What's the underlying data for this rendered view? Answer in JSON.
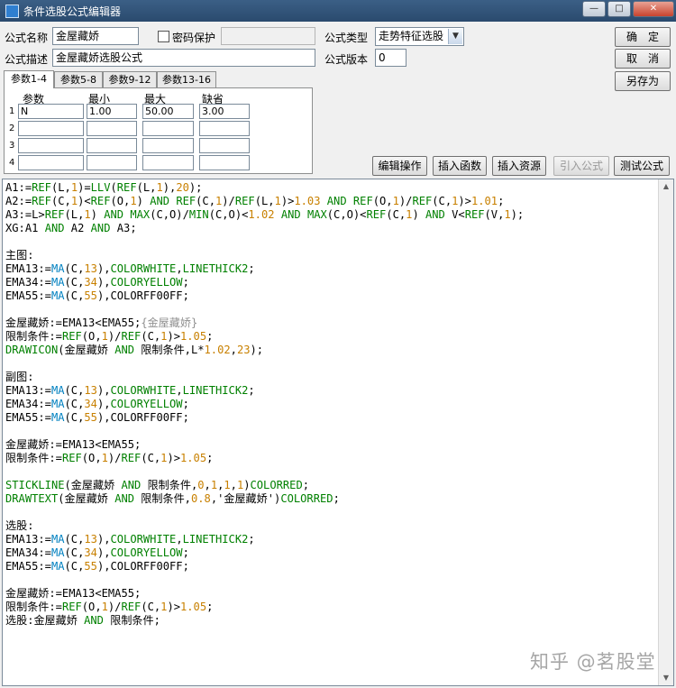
{
  "window": {
    "title": "条件选股公式编辑器",
    "min": "—",
    "max": "□",
    "close": "✕"
  },
  "form": {
    "name_label": "公式名称",
    "name_value": "金屋藏娇",
    "password_label": "密码保护",
    "password_value": "",
    "type_label": "公式类型",
    "type_value": "走势特征选股",
    "desc_label": "公式描述",
    "desc_value": "金屋藏娇选股公式",
    "version_label": "公式版本",
    "version_value": "0"
  },
  "buttons": {
    "ok": "确　定",
    "cancel": "取　消",
    "save_as": "另存为",
    "edit_ops": "编辑操作",
    "insert_func": "插入函数",
    "insert_res": "插入资源",
    "import_formula": "引入公式",
    "test_formula": "测试公式"
  },
  "tabs": [
    "参数1-4",
    "参数5-8",
    "参数9-12",
    "参数13-16"
  ],
  "params": {
    "headers": [
      "参数",
      "最小",
      "最大",
      "缺省"
    ],
    "rows": [
      {
        "num": "1",
        "name": "N",
        "min": "1.00",
        "max": "50.00",
        "default": "3.00"
      },
      {
        "num": "2",
        "name": "",
        "min": "",
        "max": "",
        "default": ""
      },
      {
        "num": "3",
        "name": "",
        "min": "",
        "max": "",
        "default": ""
      },
      {
        "num": "4",
        "name": "",
        "min": "",
        "max": "",
        "default": ""
      }
    ]
  },
  "colors": {
    "text": "#000000",
    "function": "#008000",
    "number": "#c88000",
    "constant": "#008000",
    "ma": "#0080c0",
    "comment": "#909090"
  },
  "code_lines": [
    [
      [
        "A1:=",
        "t"
      ],
      [
        "REF",
        "f"
      ],
      [
        "(L,",
        "t"
      ],
      [
        "1",
        "n"
      ],
      [
        ")=",
        "t"
      ],
      [
        "LLV",
        "f"
      ],
      [
        "(",
        "t"
      ],
      [
        "REF",
        "f"
      ],
      [
        "(L,",
        "t"
      ],
      [
        "1",
        "n"
      ],
      [
        "),",
        "t"
      ],
      [
        "20",
        "n"
      ],
      [
        ");",
        "t"
      ]
    ],
    [
      [
        "A2:=",
        "t"
      ],
      [
        "REF",
        "f"
      ],
      [
        "(C,",
        "t"
      ],
      [
        "1",
        "n"
      ],
      [
        ")<",
        "t"
      ],
      [
        "REF",
        "f"
      ],
      [
        "(O,",
        "t"
      ],
      [
        "1",
        "n"
      ],
      [
        ") ",
        "t"
      ],
      [
        "AND",
        "f"
      ],
      [
        " ",
        "t"
      ],
      [
        "REF",
        "f"
      ],
      [
        "(C,",
        "t"
      ],
      [
        "1",
        "n"
      ],
      [
        ")/",
        "t"
      ],
      [
        "REF",
        "f"
      ],
      [
        "(L,",
        "t"
      ],
      [
        "1",
        "n"
      ],
      [
        ")>",
        "t"
      ],
      [
        "1.03",
        "n"
      ],
      [
        " ",
        "t"
      ],
      [
        "AND",
        "f"
      ],
      [
        " ",
        "t"
      ],
      [
        "REF",
        "f"
      ],
      [
        "(O,",
        "t"
      ],
      [
        "1",
        "n"
      ],
      [
        ")/",
        "t"
      ],
      [
        "REF",
        "f"
      ],
      [
        "(C,",
        "t"
      ],
      [
        "1",
        "n"
      ],
      [
        ")>",
        "t"
      ],
      [
        "1.01",
        "n"
      ],
      [
        ";",
        "t"
      ]
    ],
    [
      [
        "A3:=L>",
        "t"
      ],
      [
        "REF",
        "f"
      ],
      [
        "(L,",
        "t"
      ],
      [
        "1",
        "n"
      ],
      [
        ") ",
        "t"
      ],
      [
        "AND",
        "f"
      ],
      [
        " ",
        "t"
      ],
      [
        "MAX",
        "f"
      ],
      [
        "(C,O)/",
        "t"
      ],
      [
        "MIN",
        "f"
      ],
      [
        "(C,O)<",
        "t"
      ],
      [
        "1.02",
        "n"
      ],
      [
        " ",
        "t"
      ],
      [
        "AND",
        "f"
      ],
      [
        " ",
        "t"
      ],
      [
        "MAX",
        "f"
      ],
      [
        "(C,O)<",
        "t"
      ],
      [
        "REF",
        "f"
      ],
      [
        "(C,",
        "t"
      ],
      [
        "1",
        "n"
      ],
      [
        ") ",
        "t"
      ],
      [
        "AND",
        "f"
      ],
      [
        " V<",
        "t"
      ],
      [
        "REF",
        "f"
      ],
      [
        "(V,",
        "t"
      ],
      [
        "1",
        "n"
      ],
      [
        ");",
        "t"
      ]
    ],
    [
      [
        "XG:A1 ",
        "t"
      ],
      [
        "AND",
        "f"
      ],
      [
        " A2 ",
        "t"
      ],
      [
        "AND",
        "f"
      ],
      [
        " A3;",
        "t"
      ]
    ],
    [],
    [
      [
        "主图:",
        "t"
      ]
    ],
    [
      [
        "EMA13:=",
        "t"
      ],
      [
        "MA",
        "m"
      ],
      [
        "(C,",
        "t"
      ],
      [
        "13",
        "n"
      ],
      [
        "),",
        "t"
      ],
      [
        "COLORWHITE",
        "c"
      ],
      [
        ",",
        "t"
      ],
      [
        "LINETHICK2",
        "c"
      ],
      [
        ";",
        "t"
      ]
    ],
    [
      [
        "EMA34:=",
        "t"
      ],
      [
        "MA",
        "m"
      ],
      [
        "(C,",
        "t"
      ],
      [
        "34",
        "n"
      ],
      [
        "),",
        "t"
      ],
      [
        "COLORYELLOW",
        "c"
      ],
      [
        ";",
        "t"
      ]
    ],
    [
      [
        "EMA55:=",
        "t"
      ],
      [
        "MA",
        "m"
      ],
      [
        "(C,",
        "t"
      ],
      [
        "55",
        "n"
      ],
      [
        "),COLORFF00FF;",
        "t"
      ]
    ],
    [],
    [
      [
        "金屋藏娇:=EMA13<EMA55;",
        "t"
      ],
      [
        "{金屋藏娇}",
        "x"
      ]
    ],
    [
      [
        "限制条件:=",
        "t"
      ],
      [
        "REF",
        "f"
      ],
      [
        "(O,",
        "t"
      ],
      [
        "1",
        "n"
      ],
      [
        ")/",
        "t"
      ],
      [
        "REF",
        "f"
      ],
      [
        "(C,",
        "t"
      ],
      [
        "1",
        "n"
      ],
      [
        ")>",
        "t"
      ],
      [
        "1.05",
        "n"
      ],
      [
        ";",
        "t"
      ]
    ],
    [
      [
        "DRAWICON",
        "f"
      ],
      [
        "(金屋藏娇 ",
        "t"
      ],
      [
        "AND",
        "f"
      ],
      [
        " 限制条件,L*",
        "t"
      ],
      [
        "1.02",
        "n"
      ],
      [
        ",",
        "t"
      ],
      [
        "23",
        "n"
      ],
      [
        ");",
        "t"
      ]
    ],
    [],
    [
      [
        "副图:",
        "t"
      ]
    ],
    [
      [
        "EMA13:=",
        "t"
      ],
      [
        "MA",
        "m"
      ],
      [
        "(C,",
        "t"
      ],
      [
        "13",
        "n"
      ],
      [
        "),",
        "t"
      ],
      [
        "COLORWHITE",
        "c"
      ],
      [
        ",",
        "t"
      ],
      [
        "LINETHICK2",
        "c"
      ],
      [
        ";",
        "t"
      ]
    ],
    [
      [
        "EMA34:=",
        "t"
      ],
      [
        "MA",
        "m"
      ],
      [
        "(C,",
        "t"
      ],
      [
        "34",
        "n"
      ],
      [
        "),",
        "t"
      ],
      [
        "COLORYELLOW",
        "c"
      ],
      [
        ";",
        "t"
      ]
    ],
    [
      [
        "EMA55:=",
        "t"
      ],
      [
        "MA",
        "m"
      ],
      [
        "(C,",
        "t"
      ],
      [
        "55",
        "n"
      ],
      [
        "),COLORFF00FF;",
        "t"
      ]
    ],
    [],
    [
      [
        "金屋藏娇:=EMA13<EMA55;",
        "t"
      ]
    ],
    [
      [
        "限制条件:=",
        "t"
      ],
      [
        "REF",
        "f"
      ],
      [
        "(O,",
        "t"
      ],
      [
        "1",
        "n"
      ],
      [
        ")/",
        "t"
      ],
      [
        "REF",
        "f"
      ],
      [
        "(C,",
        "t"
      ],
      [
        "1",
        "n"
      ],
      [
        ")>",
        "t"
      ],
      [
        "1.05",
        "n"
      ],
      [
        ";",
        "t"
      ]
    ],
    [],
    [
      [
        "STICKLINE",
        "f"
      ],
      [
        "(金屋藏娇 ",
        "t"
      ],
      [
        "AND",
        "f"
      ],
      [
        " 限制条件,",
        "t"
      ],
      [
        "0",
        "n"
      ],
      [
        ",",
        "t"
      ],
      [
        "1",
        "n"
      ],
      [
        ",",
        "t"
      ],
      [
        "1",
        "n"
      ],
      [
        ",",
        "t"
      ],
      [
        "1",
        "n"
      ],
      [
        ")",
        "t"
      ],
      [
        "COLORRED",
        "c"
      ],
      [
        ";",
        "t"
      ]
    ],
    [
      [
        "DRAWTEXT",
        "f"
      ],
      [
        "(金屋藏娇 ",
        "t"
      ],
      [
        "AND",
        "f"
      ],
      [
        " 限制条件,",
        "t"
      ],
      [
        "0.8",
        "n"
      ],
      [
        ",'金屋藏娇')",
        "t"
      ],
      [
        "COLORRED",
        "c"
      ],
      [
        ";",
        "t"
      ]
    ],
    [],
    [
      [
        "选股:",
        "t"
      ]
    ],
    [
      [
        "EMA13:=",
        "t"
      ],
      [
        "MA",
        "m"
      ],
      [
        "(C,",
        "t"
      ],
      [
        "13",
        "n"
      ],
      [
        "),",
        "t"
      ],
      [
        "COLORWHITE",
        "c"
      ],
      [
        ",",
        "t"
      ],
      [
        "LINETHICK2",
        "c"
      ],
      [
        ";",
        "t"
      ]
    ],
    [
      [
        "EMA34:=",
        "t"
      ],
      [
        "MA",
        "m"
      ],
      [
        "(C,",
        "t"
      ],
      [
        "34",
        "n"
      ],
      [
        "),",
        "t"
      ],
      [
        "COLORYELLOW",
        "c"
      ],
      [
        ";",
        "t"
      ]
    ],
    [
      [
        "EMA55:=",
        "t"
      ],
      [
        "MA",
        "m"
      ],
      [
        "(C,",
        "t"
      ],
      [
        "55",
        "n"
      ],
      [
        "),COLORFF00FF;",
        "t"
      ]
    ],
    [],
    [
      [
        "金屋藏娇:=EMA13<EMA55;",
        "t"
      ]
    ],
    [
      [
        "限制条件:=",
        "t"
      ],
      [
        "REF",
        "f"
      ],
      [
        "(O,",
        "t"
      ],
      [
        "1",
        "n"
      ],
      [
        ")/",
        "t"
      ],
      [
        "REF",
        "f"
      ],
      [
        "(C,",
        "t"
      ],
      [
        "1",
        "n"
      ],
      [
        ")>",
        "t"
      ],
      [
        "1.05",
        "n"
      ],
      [
        ";",
        "t"
      ]
    ],
    [
      [
        "选股:金屋藏娇 ",
        "t"
      ],
      [
        "AND",
        "f"
      ],
      [
        " 限制条件;",
        "t"
      ]
    ]
  ],
  "watermark": "知乎 @茗股堂"
}
